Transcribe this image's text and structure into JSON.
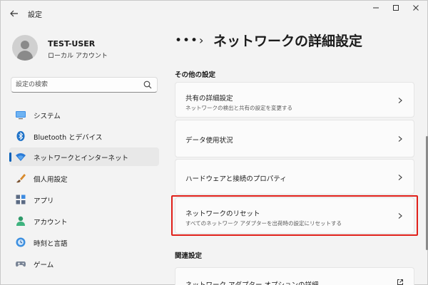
{
  "window": {
    "title": "設定",
    "back": "←",
    "minimize": "—",
    "maximize": "☐",
    "close": "✕"
  },
  "profile": {
    "name": "TEST-USER",
    "account_type": "ローカル アカウント"
  },
  "search": {
    "placeholder": "設定の検索"
  },
  "sidebar": {
    "items": [
      {
        "label": "システム",
        "icon": "monitor-icon"
      },
      {
        "label": "Bluetooth とデバイス",
        "icon": "bluetooth-icon"
      },
      {
        "label": "ネットワークとインターネット",
        "icon": "wifi-icon",
        "active": true
      },
      {
        "label": "個人用設定",
        "icon": "brush-icon"
      },
      {
        "label": "アプリ",
        "icon": "apps-icon"
      },
      {
        "label": "アカウント",
        "icon": "person-icon"
      },
      {
        "label": "時刻と言語",
        "icon": "globe-clock-icon"
      },
      {
        "label": "ゲーム",
        "icon": "gamepad-icon"
      }
    ]
  },
  "breadcrumb": {
    "overflow": "•••",
    "separator": "›",
    "title": "ネットワークの詳細設定"
  },
  "sections": {
    "other": {
      "heading": "その他の設定",
      "cards": [
        {
          "title": "共有の詳細設定",
          "desc": "ネットワークの検出と共有の設定を変更する"
        },
        {
          "title": "データ使用状況",
          "desc": ""
        },
        {
          "title": "ハードウェアと接続のプロパティ",
          "desc": ""
        },
        {
          "title": "ネットワークのリセット",
          "desc": "すべてのネットワーク アダプターを出荷時の設定にリセットする"
        }
      ]
    },
    "related": {
      "heading": "関連設定",
      "cards": [
        {
          "title": "ネットワーク アダプター オプションの詳細",
          "desc": ""
        }
      ]
    }
  },
  "colors": {
    "accent": "#005fb8",
    "highlight": "#e0201a"
  }
}
